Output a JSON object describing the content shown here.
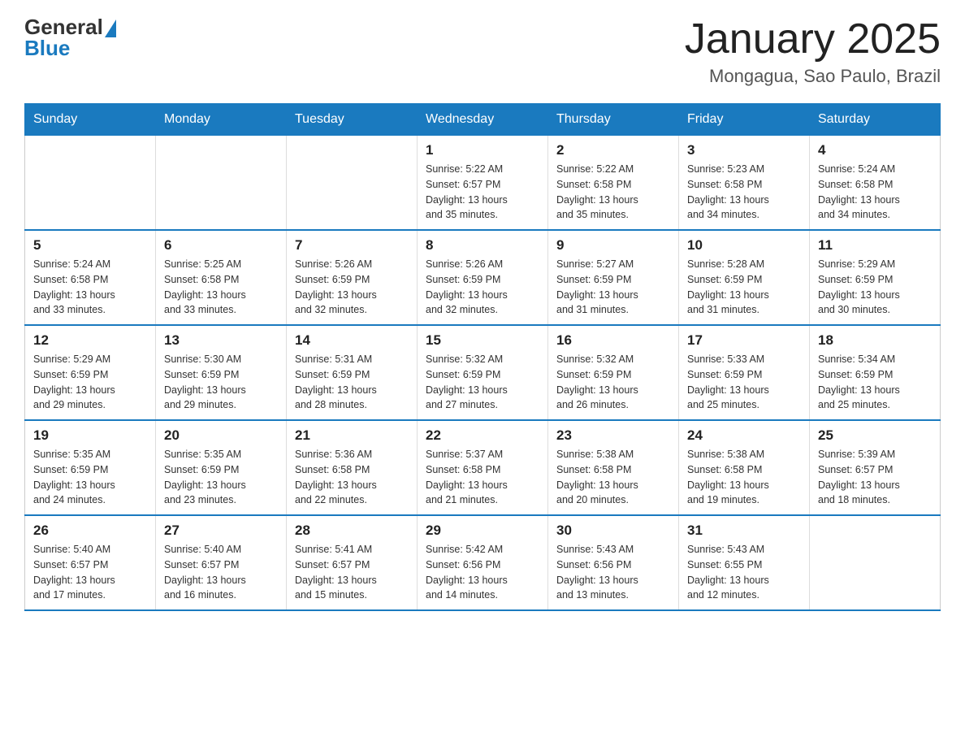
{
  "header": {
    "logo_general": "General",
    "logo_blue": "Blue",
    "title": "January 2025",
    "subtitle": "Mongagua, Sao Paulo, Brazil"
  },
  "days_of_week": [
    "Sunday",
    "Monday",
    "Tuesday",
    "Wednesday",
    "Thursday",
    "Friday",
    "Saturday"
  ],
  "weeks": [
    [
      {
        "day": "",
        "info": ""
      },
      {
        "day": "",
        "info": ""
      },
      {
        "day": "",
        "info": ""
      },
      {
        "day": "1",
        "info": "Sunrise: 5:22 AM\nSunset: 6:57 PM\nDaylight: 13 hours\nand 35 minutes."
      },
      {
        "day": "2",
        "info": "Sunrise: 5:22 AM\nSunset: 6:58 PM\nDaylight: 13 hours\nand 35 minutes."
      },
      {
        "day": "3",
        "info": "Sunrise: 5:23 AM\nSunset: 6:58 PM\nDaylight: 13 hours\nand 34 minutes."
      },
      {
        "day": "4",
        "info": "Sunrise: 5:24 AM\nSunset: 6:58 PM\nDaylight: 13 hours\nand 34 minutes."
      }
    ],
    [
      {
        "day": "5",
        "info": "Sunrise: 5:24 AM\nSunset: 6:58 PM\nDaylight: 13 hours\nand 33 minutes."
      },
      {
        "day": "6",
        "info": "Sunrise: 5:25 AM\nSunset: 6:58 PM\nDaylight: 13 hours\nand 33 minutes."
      },
      {
        "day": "7",
        "info": "Sunrise: 5:26 AM\nSunset: 6:59 PM\nDaylight: 13 hours\nand 32 minutes."
      },
      {
        "day": "8",
        "info": "Sunrise: 5:26 AM\nSunset: 6:59 PM\nDaylight: 13 hours\nand 32 minutes."
      },
      {
        "day": "9",
        "info": "Sunrise: 5:27 AM\nSunset: 6:59 PM\nDaylight: 13 hours\nand 31 minutes."
      },
      {
        "day": "10",
        "info": "Sunrise: 5:28 AM\nSunset: 6:59 PM\nDaylight: 13 hours\nand 31 minutes."
      },
      {
        "day": "11",
        "info": "Sunrise: 5:29 AM\nSunset: 6:59 PM\nDaylight: 13 hours\nand 30 minutes."
      }
    ],
    [
      {
        "day": "12",
        "info": "Sunrise: 5:29 AM\nSunset: 6:59 PM\nDaylight: 13 hours\nand 29 minutes."
      },
      {
        "day": "13",
        "info": "Sunrise: 5:30 AM\nSunset: 6:59 PM\nDaylight: 13 hours\nand 29 minutes."
      },
      {
        "day": "14",
        "info": "Sunrise: 5:31 AM\nSunset: 6:59 PM\nDaylight: 13 hours\nand 28 minutes."
      },
      {
        "day": "15",
        "info": "Sunrise: 5:32 AM\nSunset: 6:59 PM\nDaylight: 13 hours\nand 27 minutes."
      },
      {
        "day": "16",
        "info": "Sunrise: 5:32 AM\nSunset: 6:59 PM\nDaylight: 13 hours\nand 26 minutes."
      },
      {
        "day": "17",
        "info": "Sunrise: 5:33 AM\nSunset: 6:59 PM\nDaylight: 13 hours\nand 25 minutes."
      },
      {
        "day": "18",
        "info": "Sunrise: 5:34 AM\nSunset: 6:59 PM\nDaylight: 13 hours\nand 25 minutes."
      }
    ],
    [
      {
        "day": "19",
        "info": "Sunrise: 5:35 AM\nSunset: 6:59 PM\nDaylight: 13 hours\nand 24 minutes."
      },
      {
        "day": "20",
        "info": "Sunrise: 5:35 AM\nSunset: 6:59 PM\nDaylight: 13 hours\nand 23 minutes."
      },
      {
        "day": "21",
        "info": "Sunrise: 5:36 AM\nSunset: 6:58 PM\nDaylight: 13 hours\nand 22 minutes."
      },
      {
        "day": "22",
        "info": "Sunrise: 5:37 AM\nSunset: 6:58 PM\nDaylight: 13 hours\nand 21 minutes."
      },
      {
        "day": "23",
        "info": "Sunrise: 5:38 AM\nSunset: 6:58 PM\nDaylight: 13 hours\nand 20 minutes."
      },
      {
        "day": "24",
        "info": "Sunrise: 5:38 AM\nSunset: 6:58 PM\nDaylight: 13 hours\nand 19 minutes."
      },
      {
        "day": "25",
        "info": "Sunrise: 5:39 AM\nSunset: 6:57 PM\nDaylight: 13 hours\nand 18 minutes."
      }
    ],
    [
      {
        "day": "26",
        "info": "Sunrise: 5:40 AM\nSunset: 6:57 PM\nDaylight: 13 hours\nand 17 minutes."
      },
      {
        "day": "27",
        "info": "Sunrise: 5:40 AM\nSunset: 6:57 PM\nDaylight: 13 hours\nand 16 minutes."
      },
      {
        "day": "28",
        "info": "Sunrise: 5:41 AM\nSunset: 6:57 PM\nDaylight: 13 hours\nand 15 minutes."
      },
      {
        "day": "29",
        "info": "Sunrise: 5:42 AM\nSunset: 6:56 PM\nDaylight: 13 hours\nand 14 minutes."
      },
      {
        "day": "30",
        "info": "Sunrise: 5:43 AM\nSunset: 6:56 PM\nDaylight: 13 hours\nand 13 minutes."
      },
      {
        "day": "31",
        "info": "Sunrise: 5:43 AM\nSunset: 6:55 PM\nDaylight: 13 hours\nand 12 minutes."
      },
      {
        "day": "",
        "info": ""
      }
    ]
  ]
}
